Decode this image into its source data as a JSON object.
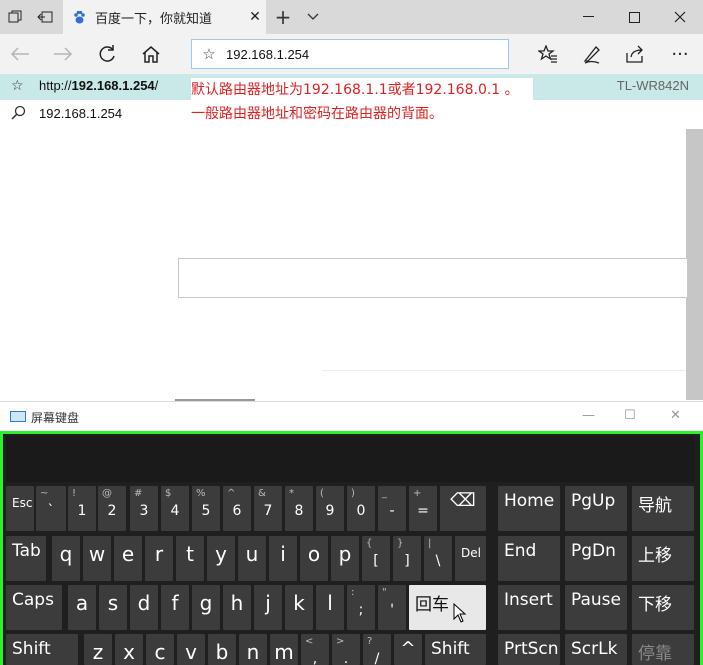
{
  "tabbar": {
    "tab_title": "百度一下，你就知道"
  },
  "address": {
    "value": "192.168.1.254"
  },
  "suggestions": [
    {
      "url_prefix": "http://",
      "url_bold": "192.168.1.254",
      "url_suffix": "/",
      "device": "TL-WR842N"
    },
    {
      "text": "192.168.1.254"
    }
  ],
  "note": {
    "line1": "默认路由器地址为192.168.1.1或者192.168.0.1 。",
    "line2": "一般路由器地址和密码在路由器的背面。"
  },
  "osk": {
    "title": "屏幕键盘",
    "rows": [
      [
        {
          "main": "Esc",
          "type": "small"
        },
        {
          "sub": "~",
          "main": "`"
        },
        {
          "sub": "!",
          "main": "1"
        },
        {
          "sub": "@",
          "main": "2"
        },
        {
          "sub": "#",
          "main": "3"
        },
        {
          "sub": "$",
          "main": "4"
        },
        {
          "sub": "%",
          "main": "5"
        },
        {
          "sub": "^",
          "main": "6"
        },
        {
          "sub": "&",
          "main": "7"
        },
        {
          "sub": "*",
          "main": "8"
        },
        {
          "sub": "(",
          "main": "9"
        },
        {
          "sub": ")",
          "main": "0"
        },
        {
          "sub": "_",
          "main": "-"
        },
        {
          "sub": "+",
          "main": "="
        },
        {
          "main": "⌫",
          "type": "icon"
        },
        {
          "main": "Home",
          "type": "big"
        },
        {
          "main": "PgUp",
          "type": "big"
        },
        {
          "main": "导航",
          "type": "big"
        }
      ],
      [
        {
          "main": "Tab",
          "type": "big"
        },
        {
          "main": "q"
        },
        {
          "main": "w"
        },
        {
          "main": "e"
        },
        {
          "main": "r"
        },
        {
          "main": "t"
        },
        {
          "main": "y"
        },
        {
          "main": "u"
        },
        {
          "main": "i"
        },
        {
          "main": "o"
        },
        {
          "main": "p"
        },
        {
          "sub": "{",
          "main": "["
        },
        {
          "sub": "}",
          "main": "]"
        },
        {
          "sub": "|",
          "main": "\\"
        },
        {
          "main": "Del",
          "type": "small"
        },
        {
          "main": "End",
          "type": "big"
        },
        {
          "main": "PgDn",
          "type": "big"
        },
        {
          "main": "上移",
          "type": "big"
        }
      ],
      [
        {
          "main": "Caps",
          "type": "big"
        },
        {
          "main": "a"
        },
        {
          "main": "s"
        },
        {
          "main": "d"
        },
        {
          "main": "f"
        },
        {
          "main": "g"
        },
        {
          "main": "h"
        },
        {
          "main": "j"
        },
        {
          "main": "k"
        },
        {
          "main": "l"
        },
        {
          "sub": ":",
          "main": ";"
        },
        {
          "sub": "\"",
          "main": "'"
        },
        {
          "main": "回车",
          "type": "big"
        },
        {
          "main": "Insert",
          "type": "big"
        },
        {
          "main": "Pause",
          "type": "big"
        },
        {
          "main": "下移",
          "type": "big"
        }
      ],
      [
        {
          "main": "Shift",
          "type": "big"
        },
        {
          "main": "z"
        },
        {
          "main": "x"
        },
        {
          "main": "c"
        },
        {
          "main": "v"
        },
        {
          "main": "b"
        },
        {
          "main": "n"
        },
        {
          "main": "m"
        },
        {
          "sub": "<",
          "main": ","
        },
        {
          "sub": ">",
          "main": "."
        },
        {
          "sub": "?",
          "main": "/"
        },
        {
          "main": "^",
          "type": "icon"
        },
        {
          "main": "Shift",
          "type": "big"
        },
        {
          "main": "PrtScn",
          "type": "big"
        },
        {
          "main": "ScrLk",
          "type": "big"
        },
        {
          "main": "停靠",
          "type": "big"
        }
      ]
    ]
  }
}
